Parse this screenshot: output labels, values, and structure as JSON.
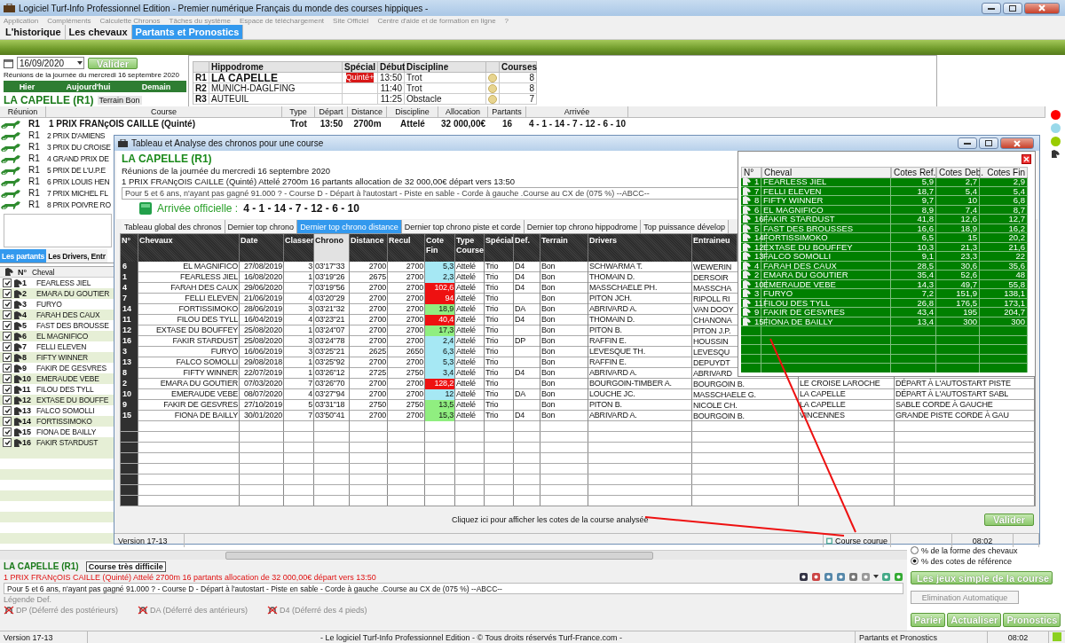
{
  "window": {
    "title": "Logiciel Turf-Info Professionnel Edition - Premier numérique Français du monde des courses hippiques -"
  },
  "menu": [
    "Application",
    "Compléments",
    "Calculette Chronos",
    "Tâches du système",
    "Espace de téléchargement",
    "Site Officiel",
    "Centre d'aide et de formation en ligne",
    "?"
  ],
  "tabs": [
    {
      "label": "L'historique",
      "selected": false
    },
    {
      "label": "Les chevaux",
      "selected": false
    },
    {
      "label": "Partants et Pronostics",
      "selected": true
    }
  ],
  "date_panel": {
    "date": "16/09/2020",
    "validate": "Valider",
    "caption": "Réunions de la journée du mercredi 16 septembre 2020",
    "nav": [
      "Hier",
      "Aujourd'hui",
      "Demain"
    ],
    "meeting": "LA CAPELLE (R1)",
    "terrain": "Terrain Bon"
  },
  "meetings": {
    "columns": [
      "Hippodrome",
      "Spécial",
      "Début",
      "Discipline",
      "Courses"
    ],
    "rows": [
      {
        "code": "R1",
        "name": "LA CAPELLE",
        "special": "Quinté+",
        "start": "13:50",
        "discipline": "Trot",
        "courses": "8",
        "selected": true
      },
      {
        "code": "R2",
        "name": "MUNICH-DAGLFING",
        "start": "11:40",
        "discipline": "Trot",
        "courses": "8",
        "selected": false
      },
      {
        "code": "R3",
        "name": "AUTEUIL",
        "start": "11:25",
        "discipline": "Obstacle",
        "courses": "7",
        "selected": false
      }
    ]
  },
  "races": {
    "columns": [
      "Réunion",
      "Course",
      "Type",
      "Départ",
      "Distance",
      "Discipline",
      "Allocation",
      "Partants",
      "Arrivée"
    ],
    "rows": [
      {
        "reunion": "R1",
        "course": "1 PRIX FRANçOIS CAILLE (Quinté)",
        "type": "Trot",
        "start": "13:50",
        "distance": "2700m",
        "discipline": "Attelé",
        "allocation": "32 000,00€",
        "runners": "16",
        "arrival": "4 - 1 - 14 - 7 - 12 - 6 - 10",
        "selected": true
      },
      {
        "reunion": "R1",
        "course": "2 PRIX D'AMIENS",
        "selected": false
      },
      {
        "reunion": "R1",
        "course": "3 PRIX DU CROISE",
        "selected": false
      },
      {
        "reunion": "R1",
        "course": "4 GRAND PRIX DE",
        "selected": false
      },
      {
        "reunion": "R1",
        "course": "5 PRIX DE L'U.P.E",
        "selected": false
      },
      {
        "reunion": "R1",
        "course": "6 PRIX LOUIS HEN",
        "selected": false
      },
      {
        "reunion": "R1",
        "course": "7 PRIX MICHEL FL",
        "selected": false
      },
      {
        "reunion": "R1",
        "course": "8 PRIX POIVRE RO",
        "selected": false
      }
    ]
  },
  "status_dots": [
    {
      "color": "#ff0000"
    },
    {
      "color": "#99d9ea"
    },
    {
      "color": "#99cc00"
    }
  ],
  "runners_panel": {
    "tabs": [
      {
        "label": "Les partants",
        "selected": true
      },
      {
        "label": "Les Drivers, Entr",
        "selected": false
      }
    ],
    "columns": [
      "N°",
      "Cheval"
    ],
    "rows": [
      {
        "number": "1",
        "name": "FEARLESS JIEL",
        "checked": true
      },
      {
        "number": "2",
        "name": "EMARA DU GOUTIER",
        "checked": true
      },
      {
        "number": "3",
        "name": "FURYO",
        "checked": true
      },
      {
        "number": "4",
        "name": "FARAH DES CAUX",
        "checked": true
      },
      {
        "number": "5",
        "name": "FAST DES BROUSSE",
        "checked": true
      },
      {
        "number": "6",
        "name": "EL MAGNIFICO",
        "checked": true
      },
      {
        "number": "7",
        "name": "FELLI ELEVEN",
        "checked": true
      },
      {
        "number": "8",
        "name": "FIFTY WINNER",
        "checked": true
      },
      {
        "number": "9",
        "name": "FAKIR DE GESVRES",
        "checked": true
      },
      {
        "number": "10",
        "name": "EMERAUDE VEBE",
        "checked": true
      },
      {
        "number": "11",
        "name": "FILOU DES TYLL",
        "checked": true
      },
      {
        "number": "12",
        "name": "EXTASE DU BOUFFE",
        "checked": true
      },
      {
        "number": "13",
        "name": "FALCO SOMOLLI",
        "checked": true
      },
      {
        "number": "14",
        "name": "FORTISSIMOKO",
        "checked": true
      },
      {
        "number": "15",
        "name": "FIONA DE BAILLY",
        "checked": true
      },
      {
        "number": "16",
        "name": "FAKIR STARDUST",
        "checked": true
      }
    ]
  },
  "modal": {
    "title": "Tableau et Analyse des chronos pour une course",
    "meeting": "LA CAPELLE (R1)",
    "caption": "Réunions de la journée du mercredi 16 septembre 2020",
    "race": "1 PRIX FRANçOIS CAILLE (Quinté) Attelé 2700m 16 partants allocation de 32 000,00€ départ vers 13:50",
    "conditions": "Pour 5 et 6 ans, n'ayant pas gagné 91.000 ? - Course D - Départ à l'autostart - Piste en sable - Corde à gauche .Course au CX de (075 %)  --ABCC--",
    "arrival_label": "Arrivée officielle :",
    "arrival": "4 - 1 - 14 - 7 - 12 - 6 - 10",
    "tabs": [
      {
        "label": "Tableau global des chronos",
        "selected": false
      },
      {
        "label": "Dernier top chrono",
        "selected": false
      },
      {
        "label": "Dernier top chrono distance",
        "selected": true
      },
      {
        "label": "Dernier top chrono piste et corde",
        "selected": false
      },
      {
        "label": "Dernier top chrono hippodrome",
        "selected": false
      },
      {
        "label": "Top puissance dévelop",
        "selected": false
      }
    ],
    "table": {
      "columns": [
        {
          "label": "N°",
          "sorted": false
        },
        {
          "label": "Chevaux",
          "sorted": false
        },
        {
          "label": "Date",
          "sorted": false
        },
        {
          "label": "Classer",
          "sorted": false
        },
        {
          "label": "Chrono",
          "sorted": true
        },
        {
          "label": "Distance",
          "sorted": false
        },
        {
          "label": "Recul",
          "sorted": false
        },
        {
          "label": "Cote Fin",
          "sorted": false
        },
        {
          "label": "Type Course",
          "sorted": false
        },
        {
          "label": "Spécial",
          "sorted": false
        },
        {
          "label": "Def.",
          "sorted": false
        },
        {
          "label": "Terrain",
          "sorted": false
        },
        {
          "label": "Drivers",
          "sorted": false
        },
        {
          "label": "Entraineu",
          "sorted": false
        }
      ],
      "rows": [
        {
          "n": "6",
          "horse": "EL MAGNIFICO",
          "date": "27/08/2019",
          "rank": "3",
          "chrono": "03'17\"33",
          "distance": "2700",
          "recul": "2700",
          "odds": "5,3",
          "color": "#a6e8f4",
          "type": "Attelé",
          "special": "Trio",
          "def": "D4",
          "terrain": "Bon",
          "driver": "SCHWARMA T.",
          "trainer": "WEWERIN"
        },
        {
          "n": "1",
          "horse": "FEARLESS JIEL",
          "date": "16/08/2020",
          "rank": "1",
          "chrono": "03'19\"26",
          "distance": "2675",
          "recul": "2700",
          "odds": "2,3",
          "color": "#a6e8f4",
          "type": "Attelé",
          "special": "Trio",
          "def": "D4",
          "terrain": "Bon",
          "driver": "THOMAIN D.",
          "trainer": "DERSOIR"
        },
        {
          "n": "4",
          "horse": "FARAH DES CAUX",
          "date": "29/06/2020",
          "rank": "7",
          "chrono": "03'19\"56",
          "distance": "2700",
          "recul": "2700",
          "odds": "102,6",
          "color": "#ee1111",
          "type": "Attelé",
          "special": "Trio",
          "def": "D4",
          "terrain": "Bon",
          "driver": "MASSCHAELE PH.",
          "trainer": "MASSCHA"
        },
        {
          "n": "7",
          "horse": "FELLI ELEVEN",
          "date": "21/06/2019",
          "rank": "4",
          "chrono": "03'20\"29",
          "distance": "2700",
          "recul": "2700",
          "odds": "94",
          "color": "#ee1111",
          "type": "Attelé",
          "special": "Trio",
          "terrain": "Bon",
          "driver": "PITON JCH.",
          "trainer": "RIPOLL RI"
        },
        {
          "n": "14",
          "horse": "FORTISSIMOKO",
          "date": "28/06/2019",
          "rank": "3",
          "chrono": "03'21\"32",
          "distance": "2700",
          "recul": "2700",
          "odds": "18,9",
          "color": "#90ee80",
          "type": "Attelé",
          "special": "Trio",
          "def": "DA",
          "terrain": "Bon",
          "driver": "ABRIVARD A.",
          "trainer": "VAN DOOY"
        },
        {
          "n": "11",
          "horse": "FILOU DES TYLL",
          "date": "16/04/2019",
          "rank": "4",
          "chrono": "03'23\"21",
          "distance": "2700",
          "recul": "2700",
          "odds": "40,4",
          "color": "#ee1111",
          "type": "Attelé",
          "special": "Trio",
          "def": "D4",
          "terrain": "Bon",
          "driver": "THOMAIN D.",
          "trainer": "CHANONA"
        },
        {
          "n": "12",
          "horse": "EXTASE DU BOUFFEY",
          "date": "25/08/2020",
          "rank": "1",
          "chrono": "03'24\"07",
          "distance": "2700",
          "recul": "2700",
          "odds": "17,3",
          "color": "#90ee80",
          "type": "Attelé",
          "special": "Trio",
          "terrain": "Bon",
          "driver": "PITON B.",
          "trainer": "PITON J.P."
        },
        {
          "n": "16",
          "horse": "FAKIR STARDUST",
          "date": "25/08/2020",
          "rank": "3",
          "chrono": "03'24\"78",
          "distance": "2700",
          "recul": "2700",
          "odds": "2,4",
          "color": "#a6e8f4",
          "type": "Attelé",
          "special": "Trio",
          "def": "DP",
          "terrain": "Bon",
          "driver": "RAFFIN E.",
          "trainer": "HOUSSIN"
        },
        {
          "n": "3",
          "horse": "FURYO",
          "date": "16/06/2019",
          "rank": "3",
          "chrono": "03'25\"21",
          "distance": "2625",
          "recul": "2650",
          "odds": "6,3",
          "color": "#a6e8f4",
          "type": "Attelé",
          "special": "Trio",
          "terrain": "Bon",
          "driver": "LEVESQUE TH.",
          "trainer": "LEVESQU"
        },
        {
          "n": "13",
          "horse": "FALCO SOMOLLI",
          "date": "29/08/2018",
          "rank": "1",
          "chrono": "03'25\"92",
          "distance": "2700",
          "recul": "2700",
          "odds": "5,3",
          "color": "#a6e8f4",
          "type": "Attelé",
          "special": "Trio",
          "terrain": "Bon",
          "driver": "RAFFIN E.",
          "trainer": "DEPUYDT"
        },
        {
          "n": "8",
          "horse": "FIFTY WINNER",
          "date": "22/07/2019",
          "rank": "1",
          "chrono": "03'26\"12",
          "distance": "2725",
          "recul": "2750",
          "odds": "3,4",
          "color": "#a6e8f4",
          "type": "Attelé",
          "special": "Trio",
          "def": "D4",
          "terrain": "Bon",
          "driver": "ABRIVARD A.",
          "trainer": "ABRIVARD"
        },
        {
          "n": "2",
          "horse": "EMARA DU GOUTIER",
          "date": "07/03/2020",
          "rank": "7",
          "chrono": "03'26\"70",
          "distance": "2700",
          "recul": "2700",
          "odds": "128,2",
          "color": "#ee1111",
          "type": "Attelé",
          "special": "Trio",
          "terrain": "Bon",
          "driver": "BOURGOIN-TIMBER A.",
          "trainer": "BOURGOIN B.",
          "column_15": "LE CROISE LAROCHE",
          "column_16": "DÉPART À L'AUTOSTART PISTE"
        },
        {
          "n": "10",
          "horse": "EMERAUDE VEBE",
          "date": "08/07/2020",
          "rank": "4",
          "chrono": "03'27\"94",
          "distance": "2700",
          "recul": "2700",
          "odds": "12",
          "color": "#a6e8f4",
          "type": "Attelé",
          "special": "Trio",
          "def": "DA",
          "terrain": "Bon",
          "driver": "LOUCHE JC.",
          "trainer": "MASSCHAELE G.",
          "column_15": "LA CAPELLE",
          "column_16": "DÉPART À L'AUTOSTART SABL"
        },
        {
          "n": "9",
          "horse": "FAKIR DE GESVRES",
          "date": "27/10/2019",
          "rank": "5",
          "chrono": "03'31\"18",
          "distance": "2750",
          "recul": "2750",
          "odds": "13,5",
          "color": "#90ee80",
          "type": "Attelé",
          "special": "Trio",
          "terrain": "Bon",
          "driver": "PITON B.",
          "trainer": "NICOLE CH.",
          "column_15": "LA CAPELLE",
          "column_16": "SABLE CORDE À GAUCHE"
        },
        {
          "n": "15",
          "horse": "FIONA DE BAILLY",
          "date": "30/01/2020",
          "rank": "7",
          "chrono": "03'50\"41",
          "distance": "2700",
          "recul": "2700",
          "odds": "15,3",
          "color": "#90ee80",
          "type": "Attelé",
          "special": "Trio",
          "def": "D4",
          "terrain": "Bon",
          "driver": "ABRIVARD A.",
          "trainer": "BOURGOIN B.",
          "column_15": "VINCENNES",
          "column_16": "GRANDE PISTE CORDE À GAU"
        }
      ]
    },
    "odds_panel": {
      "columns": [
        "N°",
        "Cheval",
        "Cotes Ref.",
        "Cotes Deb.",
        "Cotes Fin"
      ],
      "rows": [
        {
          "n": "1",
          "horse": "FEARLESS JIEL",
          "ref": "5,9",
          "deb": "2,7",
          "fin": "2,9"
        },
        {
          "n": "7",
          "horse": "FELLI ELEVEN",
          "ref": "18,7",
          "deb": "5,4",
          "fin": "5,4"
        },
        {
          "n": "8",
          "horse": "FIFTY WINNER",
          "ref": "9,7",
          "deb": "10",
          "fin": "6,8"
        },
        {
          "n": "6",
          "horse": "EL MAGNIFICO",
          "ref": "8,9",
          "deb": "7,4",
          "fin": "8,7"
        },
        {
          "n": "16",
          "horse": "FAKIR STARDUST",
          "ref": "41,8",
          "deb": "12,6",
          "fin": "12,7"
        },
        {
          "n": "5",
          "horse": "FAST DES BROUSSES",
          "ref": "16,6",
          "deb": "18,9",
          "fin": "16,2"
        },
        {
          "n": "14",
          "horse": "FORTISSIMOKO",
          "ref": "6,5",
          "deb": "15",
          "fin": "20,2"
        },
        {
          "n": "12",
          "horse": "EXTASE DU BOUFFEY",
          "ref": "10,3",
          "deb": "21,3",
          "fin": "21,6"
        },
        {
          "n": "13",
          "horse": "FALCO SOMOLLI",
          "ref": "9,1",
          "deb": "23,3",
          "fin": "22"
        },
        {
          "n": "4",
          "horse": "FARAH DES CAUX",
          "ref": "28,5",
          "deb": "30,6",
          "fin": "35,6"
        },
        {
          "n": "2",
          "horse": "EMARA DU GOUTIER",
          "ref": "35,4",
          "deb": "52,6",
          "fin": "48"
        },
        {
          "n": "10",
          "horse": "EMERAUDE VEBE",
          "ref": "14,3",
          "deb": "49,7",
          "fin": "55,8"
        },
        {
          "n": "3",
          "horse": "FURYO",
          "ref": "7,2",
          "deb": "151,9",
          "fin": "138,1"
        },
        {
          "n": "11",
          "horse": "FILOU DES TYLL",
          "ref": "26,8",
          "deb": "176,5",
          "fin": "173,1"
        },
        {
          "n": "9",
          "horse": "FAKIR DE GESVRES",
          "ref": "43,4",
          "deb": "195",
          "fin": "204,7"
        },
        {
          "n": "15",
          "horse": "FIONA DE BAILLY",
          "ref": "13,4",
          "deb": "300",
          "fin": "300"
        }
      ]
    },
    "hint": "Cliquez ici pour afficher les cotes de la course analysée",
    "validate": "Valider",
    "status": {
      "version": "Version 17-13",
      "button": "Course courue",
      "time": "08:02"
    }
  },
  "bottom": {
    "meeting": "LA CAPELLE (R1)",
    "difficulty": "Course très difficile",
    "race": "1 PRIX FRANçOIS CAILLE (Quinté) Attelé 2700m 16 partants allocation de 32 000,00€ départ vers 13:50",
    "conditions": "Pour 5 et 6 ans, n'ayant pas gagné 91.000 ? - Course D - Départ à l'autostart - Piste en sable - Corde à gauche .Course au CX de (075 %)  --ABCC--",
    "legend_title": "Légende Def.",
    "legend": [
      "DP (Déferré des postérieurs)",
      "DA (Déferré des antérieurs)",
      "D4 (Déferré des 4 pieds)"
    ]
  },
  "options": [
    {
      "label": "% de la forme des chevaux",
      "selected": false
    },
    {
      "label": "% des cotes de référence",
      "selected": true
    }
  ],
  "side_buttons": [
    "Les jeux simple de la course",
    "Elimination Automatique"
  ],
  "action_buttons": [
    "Parier",
    "Actualiser",
    "Pronostics"
  ],
  "status_bar": {
    "version": "Version 17-13",
    "copyright": "- Le logiciel Turf-Info Professionnel Edition - © Tous droits réservés Turf-France.com -",
    "section": "Partants et Pronostics",
    "time": "08:02"
  }
}
